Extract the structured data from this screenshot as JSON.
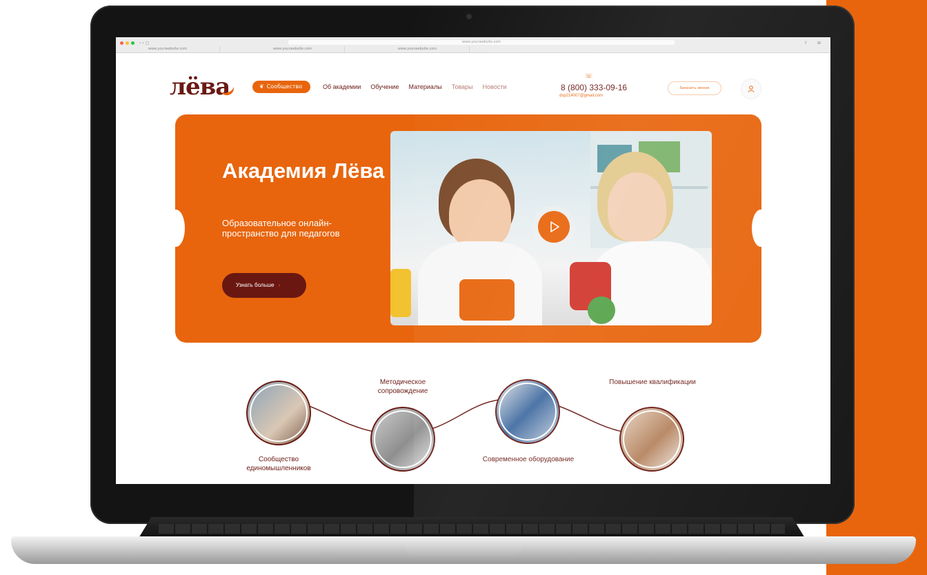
{
  "brand": {
    "logo_text": "лёва",
    "accent": "#e8650d",
    "dark": "#6a1a14"
  },
  "browser": {
    "url": "www.yourwebsite.com",
    "tabs": [
      "www.yourwebsite.com",
      "www.yourwebsite.com",
      "www.yourwebsite.com"
    ]
  },
  "header": {
    "nav_pill": "Сообщество",
    "nav": [
      "Об академии",
      "Обучение",
      "Материалы",
      "Товары",
      "Новости"
    ],
    "phone": "8 (800) 333-09-16",
    "email": "dsp214007@gmail.com",
    "callback": "Заказать звонок",
    "user_icon": "user-icon"
  },
  "hero": {
    "title": "Академия Лёва",
    "subtitle": "Образовательное онлайн-пространство для педагогов",
    "cta": "Узнать больше",
    "cta_chevron": "›",
    "video_icon": "play-icon"
  },
  "features": [
    {
      "label": "Сообщество единомышленников"
    },
    {
      "label": "Методическое сопровождение"
    },
    {
      "label": "Современное оборудование"
    },
    {
      "label": "Повышение квалификации"
    }
  ]
}
